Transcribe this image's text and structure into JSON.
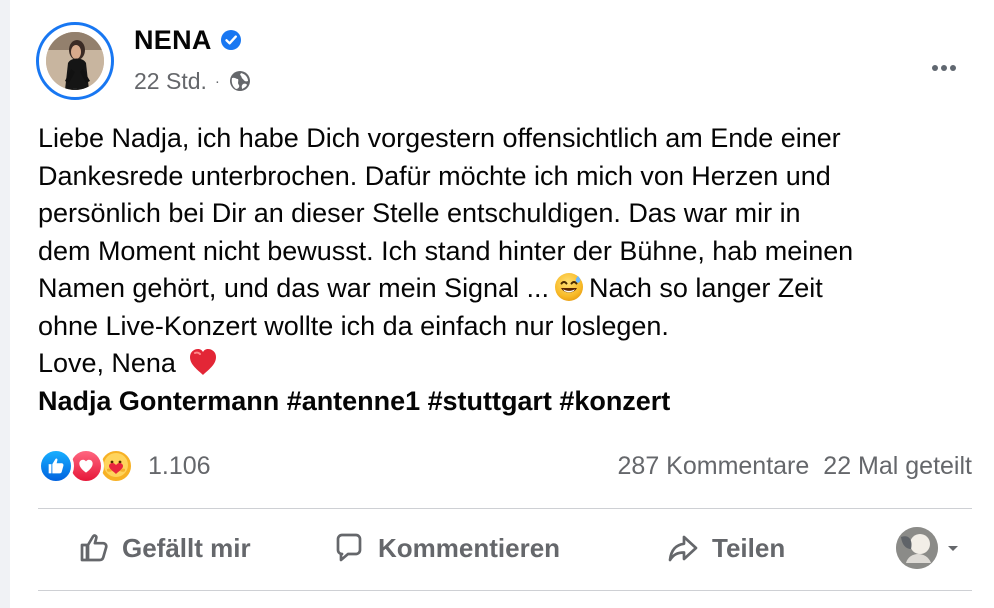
{
  "post": {
    "author": "NENA",
    "time": "22 Std.",
    "meta_separator": "·",
    "message_lines": [
      "Liebe Nadja, ich habe Dich vorgestern offensichtlich am Ende einer",
      "Dankesrede unterbrochen. Dafür möchte ich mich von Herzen und",
      "persönlich bei Dir an dieser Stelle entschuldigen. Das war mir in",
      "dem Moment nicht bewusst. Ich stand hinter der Bühne, hab meinen"
    ],
    "message_line5_before_emoji": "Namen gehört, und das war mein Signal ...",
    "message_line5_after_emoji": "Nach so langer Zeit",
    "message_line6": "ohne Live-Konzert wollte ich da einfach nur loslegen.",
    "message_love": "Love, Nena",
    "tags": {
      "name": "Nadja Gontermann",
      "antenne": "#antenne1",
      "stuttgart": "#stuttgart",
      "konzert": "#konzert"
    },
    "icons": {
      "verified": "verified-badge-icon",
      "privacy": "globe-icon",
      "emoji": "grinning-sweat-emoji-icon",
      "heart": "red-heart-icon"
    }
  },
  "stats": {
    "reaction_count": "1.106",
    "comments": "287 Kommentare",
    "shares": "22 Mal geteilt",
    "reactions": [
      "like",
      "love",
      "care"
    ],
    "colors": {
      "like": "#1877f2",
      "love": "#f02849",
      "care": "#f7b928"
    }
  },
  "actions": {
    "like_label": "Gefällt mir",
    "comment_label": "Kommentieren",
    "share_label": "Teilen",
    "icons": {
      "like": "thumbs-up-icon",
      "comment": "speech-bubble-icon",
      "share": "share-arrow-icon",
      "audience": "chevron-down-icon"
    }
  },
  "theme": {
    "secondary_text": "#65676b",
    "divider": "#ced0d4",
    "accent": "#1877f2"
  }
}
